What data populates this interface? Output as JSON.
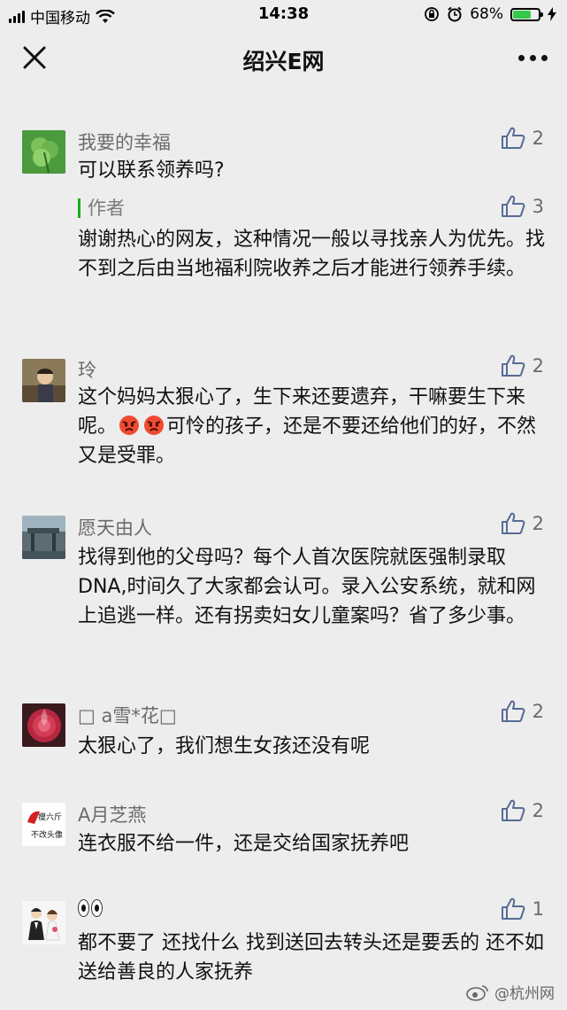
{
  "status": {
    "carrier": "中国移动",
    "time": "14:38",
    "battery": "68%",
    "battery_level": 0.68
  },
  "nav": {
    "title": "绍兴E网"
  },
  "comments": [
    {
      "nickname": "我要的幸福",
      "likes": "2",
      "text": "可以联系领养吗?",
      "reply": {
        "tag": "作者",
        "likes": "3",
        "text": "谢谢热心的网友，这种情况一般以寻找亲人为优先。找不到之后由当地福利院收养之后才能进行领养手续。"
      }
    },
    {
      "nickname": "玲",
      "likes": "2",
      "text_a": "这个妈妈太狠心了，生下来还要遗弃，干嘛要生下来呢。",
      "text_b": "可怜的孩子，还是不要还给他们的好，不然又是受罪。"
    },
    {
      "nickname": "愿天由人",
      "likes": "2",
      "text": "找得到他的父母吗？每个人首次医院就医强制录取DNA,时间久了大家都会认可。录入公安系统，就和网上追逃一样。还有拐卖妇女儿童案吗？省了多少事。"
    },
    {
      "nickname": "□ a雪*花□",
      "likes": "2",
      "text": "太狠心了，我们想生女孩还没有呢"
    },
    {
      "nickname": "A月芝燕",
      "likes": "2",
      "text": "连衣服不给一件，还是交给国家抚养吧",
      "avatar_text_1": "瘦六斤",
      "avatar_text_2": "不改头像"
    },
    {
      "likes": "1",
      "text": "都不要了 还找什么 找到送回去转头还是要丢的 还不如送给善良的人家抚养"
    }
  ],
  "watermark": "@杭州网"
}
